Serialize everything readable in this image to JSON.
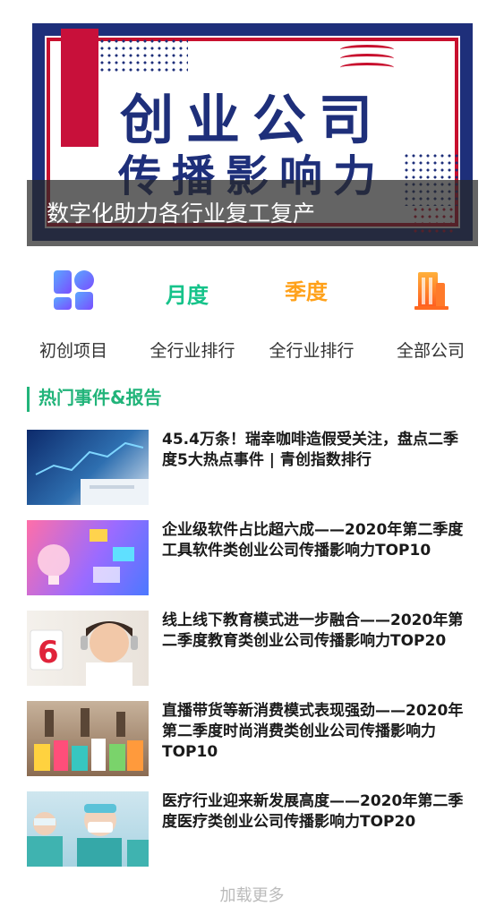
{
  "banner": {
    "title_line1": "创业公司",
    "title_line2": "传播影响力",
    "caption": "数字化助力各行业复工复产"
  },
  "nav": [
    {
      "label": "初创项目",
      "icon": "grid-icon",
      "glyph": ""
    },
    {
      "label": "全行业排行",
      "icon": "monthly-icon",
      "glyph": "月度"
    },
    {
      "label": "全行业排行",
      "icon": "quarterly-icon",
      "glyph": "季度"
    },
    {
      "label": "全部公司",
      "icon": "building-icon",
      "glyph": ""
    }
  ],
  "section_title": "热门事件&报告",
  "articles": [
    {
      "title": "45.4万条！瑞幸咖啡造假受关注，盘点二季度5大热点事件 | 青创指数排行"
    },
    {
      "title": "企业级软件占比超六成——2020年第二季度工具软件类创业公司传播影响力TOP10"
    },
    {
      "title": "线上线下教育模式进一步融合——2020年第二季度教育类创业公司传播影响力TOP20"
    },
    {
      "title": "直播带货等新消费模式表现强劲——2020年第二季度时尚消费类创业公司传播影响力TOP10"
    },
    {
      "title": "医疗行业迎来新发展高度——2020年第二季度医疗类创业公司传播影响力TOP20"
    }
  ],
  "load_more": "加载更多",
  "colors": {
    "accent": "#22b47a",
    "banner_navy": "#1e2f7a",
    "banner_red": "#c8102e"
  }
}
